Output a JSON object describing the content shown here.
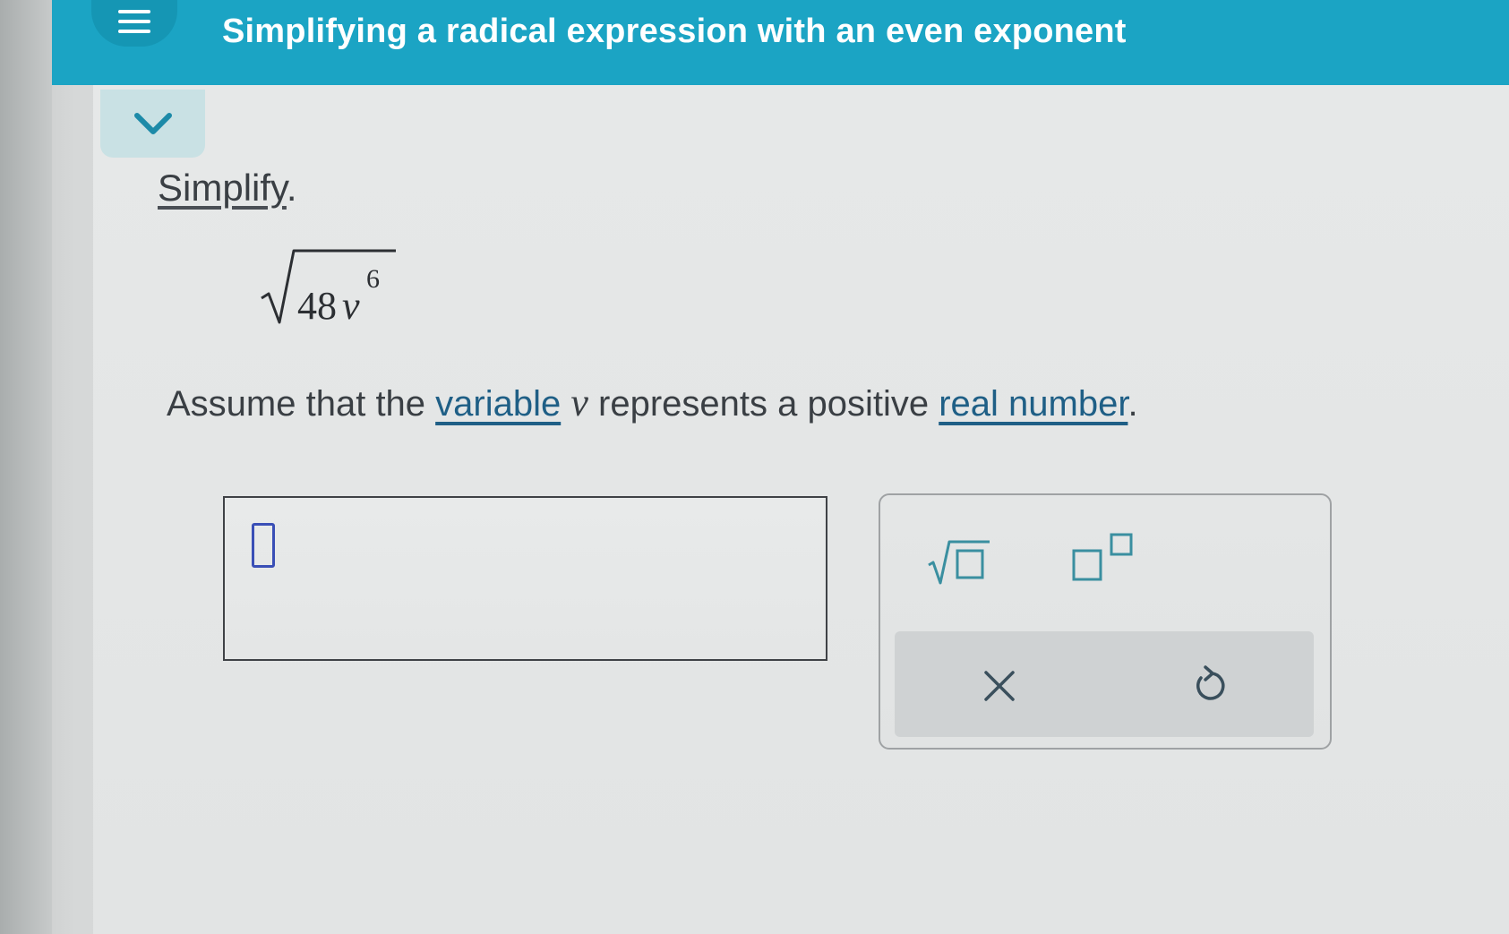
{
  "header": {
    "title": "Simplifying a radical expression with an even exponent",
    "menu_icon": "hamburger-menu-icon",
    "background_color": "#1ba4c4"
  },
  "collapse_tab": {
    "icon": "chevron-down-icon"
  },
  "problem": {
    "instruction_link": "Simplify",
    "instruction_suffix": ".",
    "expression": {
      "coefficient": "48",
      "variable": "v",
      "exponent": "6"
    },
    "assumption": {
      "prefix": "Assume that the ",
      "variable_link": "variable",
      "middle_space": " ",
      "variable_symbol": "v",
      "middle_text": " represents a positive ",
      "real_number_link": "real number",
      "suffix": "."
    }
  },
  "answer": {
    "value": "",
    "placeholder_icon": "empty-placeholder-box-icon",
    "cursor_color": "#3a4fb6"
  },
  "keypad": {
    "buttons": [
      {
        "name": "square-root",
        "icon": "square-root-icon"
      },
      {
        "name": "exponent",
        "icon": "superscript-power-icon"
      },
      {
        "name": "clear",
        "icon": "close-x-icon"
      },
      {
        "name": "undo",
        "icon": "undo-arrow-icon"
      }
    ],
    "accent_color": "#3a8fa0"
  }
}
